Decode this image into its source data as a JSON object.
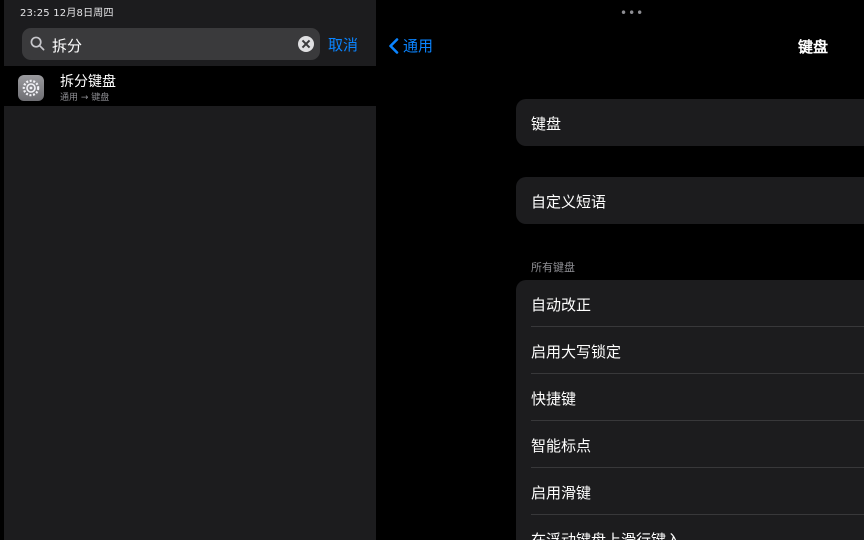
{
  "status_bar": {
    "time_date": "23:25  12月8日周四"
  },
  "search": {
    "query": "拆分",
    "cancel_label": "取消"
  },
  "results": [
    {
      "title": "拆分键盘",
      "path": "通用 → 键盘"
    }
  ],
  "nav": {
    "back_label": "通用",
    "title": "键盘",
    "more_dots": "•••"
  },
  "groups": {
    "g1": [
      "键盘"
    ],
    "g2": [
      "自定义短语"
    ],
    "all_keyboards_header": "所有键盘",
    "g3": [
      "自动改正",
      "启用大写锁定",
      "快捷键",
      "智能标点",
      "启用滑键",
      "在浮动键盘上滑行键入"
    ]
  },
  "colors": {
    "accent": "#0a84ff",
    "cell": "#1c1c1e",
    "background": "#000000"
  },
  "icons": {
    "search": "magnifier",
    "clear": "x-circle",
    "settings": "gear",
    "back": "chevron-left"
  }
}
